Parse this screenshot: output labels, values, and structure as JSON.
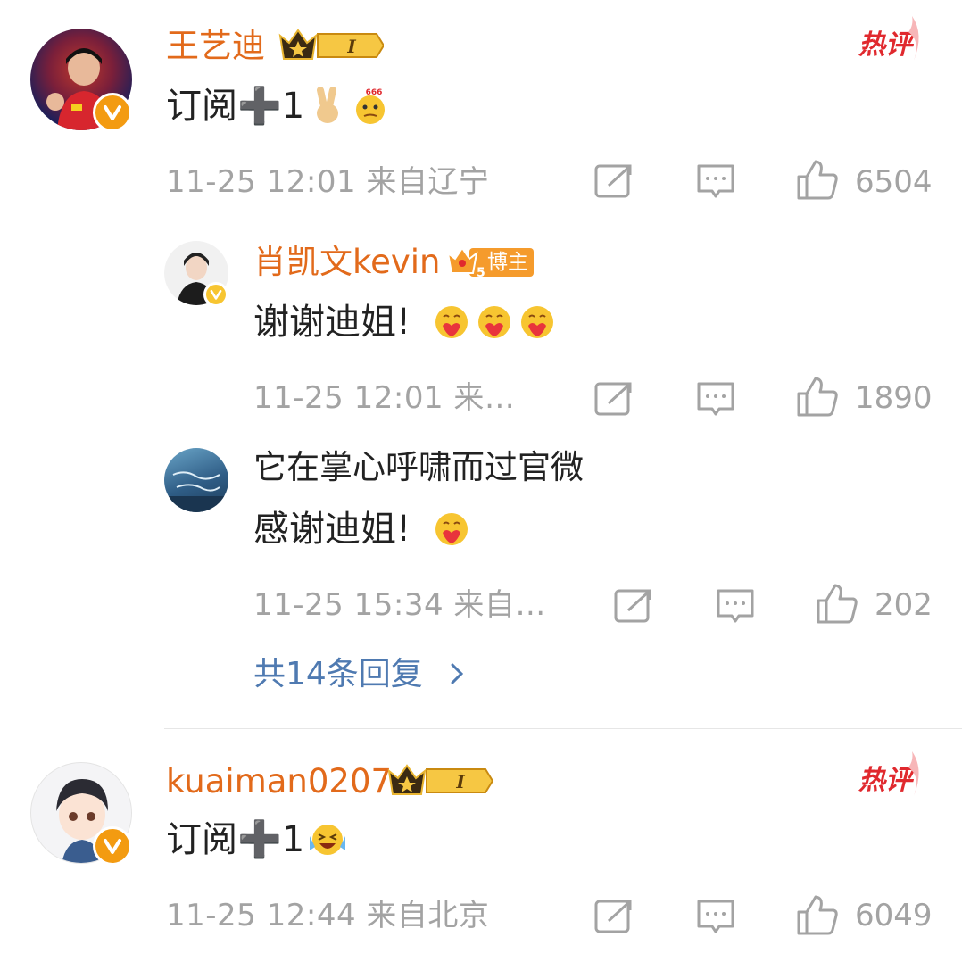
{
  "comments": [
    {
      "username": "王艺迪",
      "text": "订阅➕1",
      "meta": "11-25 12:01 来自辽宁",
      "likes": "6504",
      "hot_label": "热评",
      "level_label": "I",
      "replies": [
        {
          "username": "肖凯文kevin",
          "badge_label": "博主",
          "badge_level": "5",
          "text": "谢谢迪姐!",
          "meta": "11-25 12:01 来…",
          "likes": "1890"
        },
        {
          "username": "它在掌心呼啸而过官微",
          "text": "感谢迪姐!",
          "meta": "11-25 15:34 来自…",
          "likes": "202"
        }
      ],
      "more_replies": "共14条回复"
    },
    {
      "username": "kuaiman0207",
      "text": "订阅➕1",
      "meta": "11-25 12:44 来自北京",
      "likes": "6049",
      "hot_label": "热评",
      "level_label": "I"
    }
  ],
  "emoji_badge_666": "666",
  "colors": {
    "username": "#e26a1b",
    "meta": "#a3a3a3",
    "link": "#4f7ab1",
    "hot": "#e0292e",
    "verified": "#f39b11"
  },
  "icons": [
    "repost-icon",
    "comment-icon",
    "like-icon",
    "chevron-right-icon",
    "crown-level-icon",
    "verified-v-icon"
  ]
}
